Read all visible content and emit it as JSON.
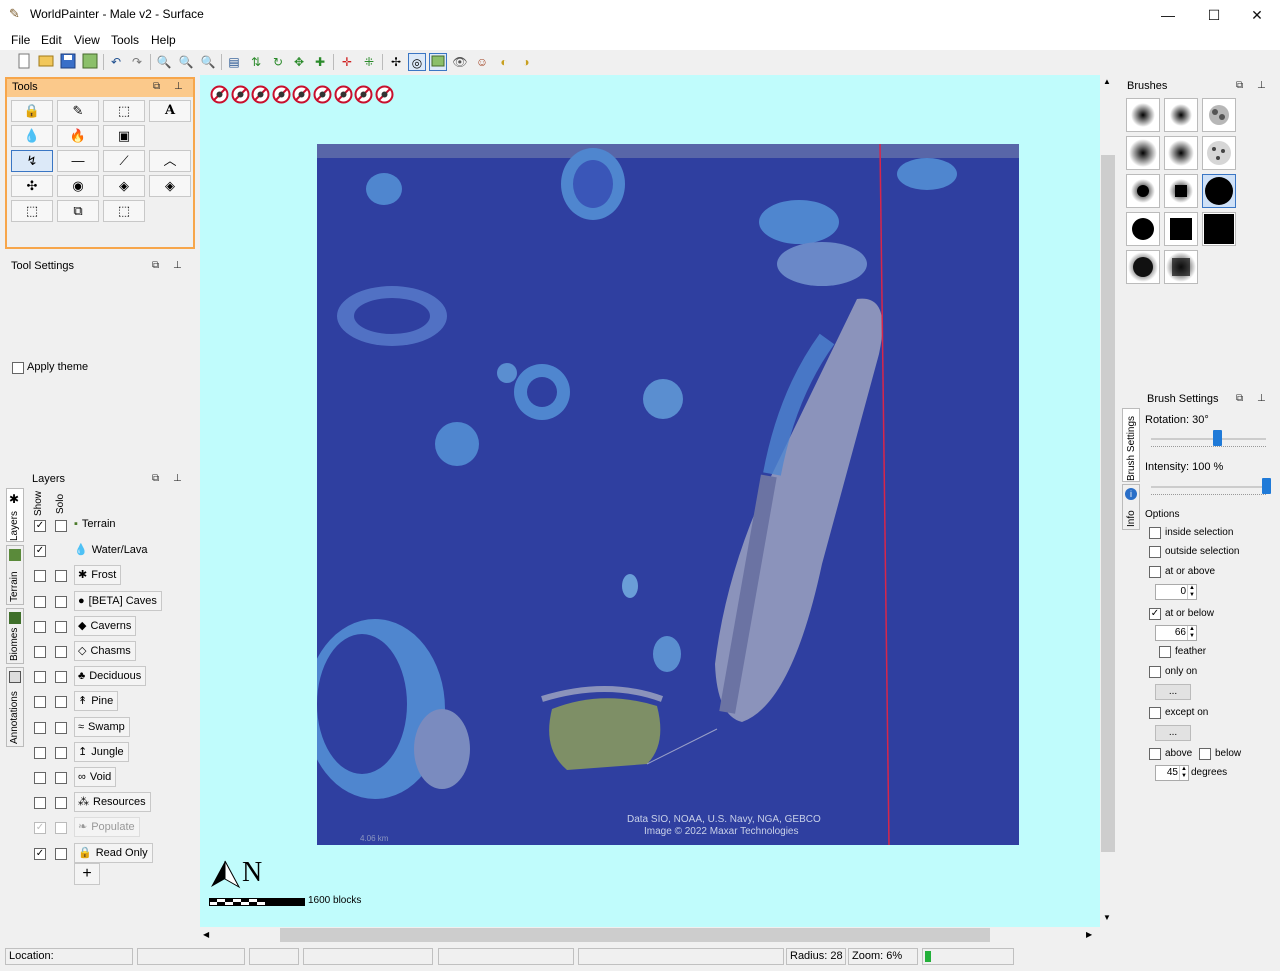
{
  "window": {
    "title": "WorldPainter - Male v2 - Surface",
    "minimize": "—",
    "maximize": "☐",
    "close": "✕"
  },
  "menu": [
    "File",
    "Edit",
    "View",
    "Tools",
    "Help"
  ],
  "toolbar": {
    "icons": [
      "new-icon",
      "open-icon",
      "save-icon",
      "export-icon",
      "undo-icon",
      "redo-icon",
      "zoom-icon",
      "zoom-in-icon",
      "zoom-out-icon",
      "zoom-reset-icon",
      "dimension-icon",
      "height-icon",
      "rotate-icon",
      "shift-icon",
      "merge-icon",
      "crosshair-icon",
      "grid-icon",
      "move-icon",
      "target-icon",
      "image-overlay-icon",
      "eye-icon",
      "person-icon",
      "globe-icon",
      "globe-settings-icon"
    ]
  },
  "tools_panel": {
    "title": "Tools",
    "restore_glyph": "⧉",
    "pin_glyph": "⊥",
    "buttons": [
      "🔒",
      "✎",
      "⬚",
      "A",
      "💧",
      "🔥",
      "▣",
      "↯",
      "—",
      "⟋",
      "︿",
      "✣",
      "◉",
      "◈",
      "◈",
      "⬚",
      "⧉",
      "⬚"
    ]
  },
  "tool_settings": {
    "title": "Tool Settings",
    "apply_theme": "Apply theme",
    "dot": "ᵒ"
  },
  "side_tabs": {
    "layers": "Layers",
    "terrain": "Terrain",
    "biomes": "Biomes",
    "annotations": "Annotations"
  },
  "layers": {
    "title": "Layers",
    "show_header": "Show",
    "solo_header": "Solo",
    "add_label": "+",
    "rows": [
      {
        "name": "Terrain",
        "icon": "▪",
        "show": "✓",
        "solo": "",
        "button": false,
        "disabled": false
      },
      {
        "name": "Water/Lava",
        "icon": "💧",
        "show": "✓",
        "solo": null,
        "button": false,
        "disabled": false
      },
      {
        "name": "Frost",
        "icon": "✱",
        "show": "",
        "solo": "",
        "button": true,
        "disabled": false
      },
      {
        "name": "[BETA] Caves",
        "icon": "●",
        "show": "",
        "solo": "",
        "button": true,
        "disabled": false
      },
      {
        "name": "Caverns",
        "icon": "◆",
        "show": "",
        "solo": "",
        "button": true,
        "disabled": false
      },
      {
        "name": "Chasms",
        "icon": "◇",
        "show": "",
        "solo": "",
        "button": true,
        "disabled": false
      },
      {
        "name": "Deciduous",
        "icon": "♣",
        "show": "",
        "solo": "",
        "button": true,
        "disabled": false
      },
      {
        "name": "Pine",
        "icon": "↟",
        "show": "",
        "solo": "",
        "button": true,
        "disabled": false
      },
      {
        "name": "Swamp",
        "icon": "≈",
        "show": "",
        "solo": "",
        "button": true,
        "disabled": false
      },
      {
        "name": "Jungle",
        "icon": "↥",
        "show": "",
        "solo": "",
        "button": true,
        "disabled": false
      },
      {
        "name": "Void",
        "icon": "∞",
        "show": "",
        "solo": "",
        "button": true,
        "disabled": false
      },
      {
        "name": "Resources",
        "icon": "⁂",
        "show": "",
        "solo": "",
        "button": true,
        "disabled": false
      },
      {
        "name": "Populate",
        "icon": "❧",
        "show": "✓",
        "solo": "",
        "button": true,
        "disabled": true
      },
      {
        "name": "Read Only",
        "icon": "🔒",
        "show": "✓",
        "solo": "",
        "button": true,
        "disabled": false
      }
    ]
  },
  "map": {
    "overlay_icons_count": 9,
    "attribution_line1": "Data SIO, NOAA, U.S. Navy, NGA, GEBCO",
    "attribution_line2": "Image © 2022 Maxar Technologies",
    "scale_text": "4.06 km",
    "compass_label": "N",
    "scale_label": "1600 blocks",
    "background_color": "#c0fcfc",
    "sea_color": "#2f3fa0"
  },
  "brushes": {
    "title": "Brushes",
    "restore_glyph": "⧉",
    "pin_glyph": "⊥"
  },
  "brush_settings": {
    "title": "Brush Settings",
    "tab_brush": "Brush Settings",
    "tab_info": "Info",
    "rotation_label": "Rotation: 30°",
    "rotation_fraction": 0.57,
    "intensity_label": "Intensity: 100 %",
    "intensity_fraction": 1.0,
    "options_label": "Options",
    "inside_selection": "inside selection",
    "outside_selection": "outside selection",
    "at_or_above": "at or above",
    "at_or_above_value": "0",
    "at_or_below": "at or below",
    "at_or_below_checked": "✓",
    "at_or_below_value": "66",
    "feather": "feather",
    "only_on": "only on",
    "except_on": "except on",
    "dots": "...",
    "above": "above",
    "below": "below",
    "degrees_value": "45",
    "degrees": "degrees"
  },
  "status": {
    "location": "Location:",
    "radius": "Radius: 28",
    "zoom": "Zoom: 6%"
  },
  "scroll": {
    "up": "▲",
    "down": "▼",
    "left": "◀",
    "right": "▶"
  }
}
